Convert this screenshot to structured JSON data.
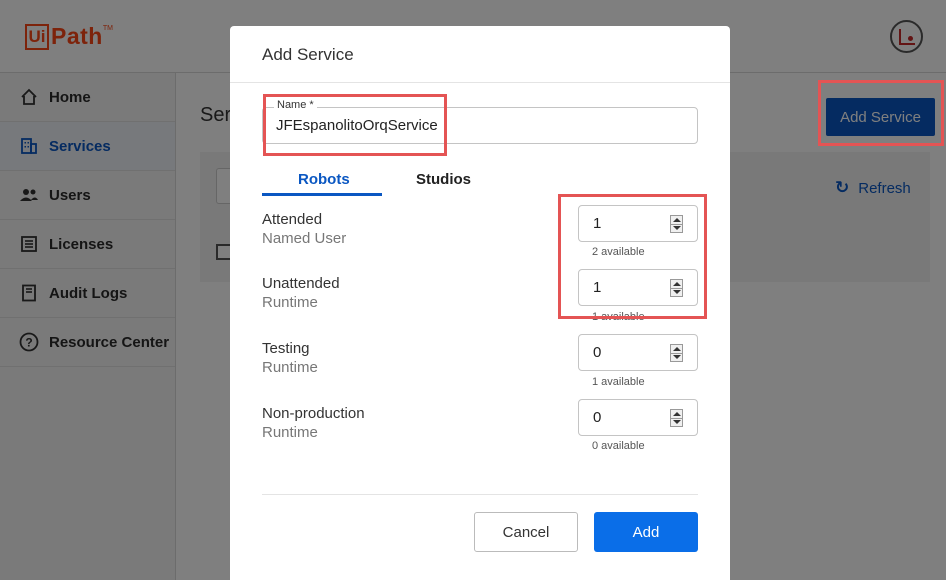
{
  "app": {
    "logo_text": "UiPath",
    "logo_box": "Ui",
    "logo_path": "Path",
    "logo_tm": "TM"
  },
  "sidebar": {
    "items": [
      {
        "label": "Home",
        "icon": "home-icon",
        "active": false
      },
      {
        "label": "Services",
        "icon": "building-icon",
        "active": true
      },
      {
        "label": "Users",
        "icon": "users-icon",
        "active": false
      },
      {
        "label": "Licenses",
        "icon": "list-icon",
        "active": false
      },
      {
        "label": "Audit Logs",
        "icon": "book-icon",
        "active": false
      },
      {
        "label": "Resource Center",
        "icon": "help-icon",
        "active": false
      }
    ]
  },
  "main": {
    "title": "Services",
    "add_service_label": "Add Service",
    "refresh_label": "Refresh"
  },
  "modal": {
    "title": "Add Service",
    "name_label": "Name *",
    "name_value": "JFEspanolitoOrqService",
    "tabs": [
      "Robots",
      "Studios"
    ],
    "rows": [
      {
        "label": "Attended",
        "sub": "Named User",
        "value": "1",
        "available": "2 available"
      },
      {
        "label": "Unattended",
        "sub": "Runtime",
        "value": "1",
        "available": "1 available"
      },
      {
        "label": "Testing",
        "sub": "Runtime",
        "value": "0",
        "available": "1 available"
      },
      {
        "label": "Non-production",
        "sub": "Runtime",
        "value": "0",
        "available": "0 available"
      }
    ],
    "cancel_label": "Cancel",
    "add_label": "Add"
  },
  "colors": {
    "accent": "#0a57c2",
    "primary_button": "#0a6ee8",
    "highlight": "#e45454",
    "brand": "#fa4616"
  }
}
